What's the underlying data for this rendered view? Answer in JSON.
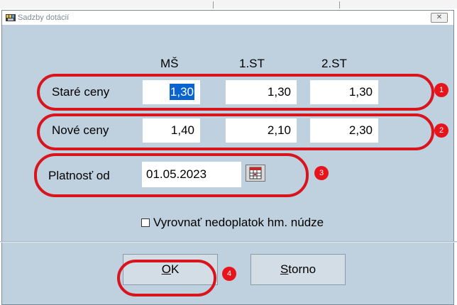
{
  "window": {
    "title": "Sadzby dotácií",
    "close_icon": "close-icon"
  },
  "columns": [
    "MŠ",
    "1.ST",
    "2.ST"
  ],
  "rows": [
    {
      "label": "Staré ceny",
      "values": [
        "1,30",
        "1,30",
        "1,30"
      ]
    },
    {
      "label": "Nové ceny",
      "values": [
        "1,40",
        "2,10",
        "2,30"
      ]
    }
  ],
  "validity": {
    "label": "Platnosť od",
    "date": "01.05.2023",
    "icon": "calendar-icon"
  },
  "checkbox": {
    "label": "Vyrovnať nedoplatok hm. núdze",
    "checked": false
  },
  "buttons": {
    "ok": {
      "mnemonic": "O",
      "rest": "K"
    },
    "cancel": {
      "mnemonic": "S",
      "rest": "torno"
    }
  },
  "annotations": [
    "1",
    "2",
    "3",
    "4"
  ],
  "colors": {
    "annotation": "#d8141c",
    "selection": "#0a64d0",
    "dialog_bg": "#bfd0df"
  }
}
